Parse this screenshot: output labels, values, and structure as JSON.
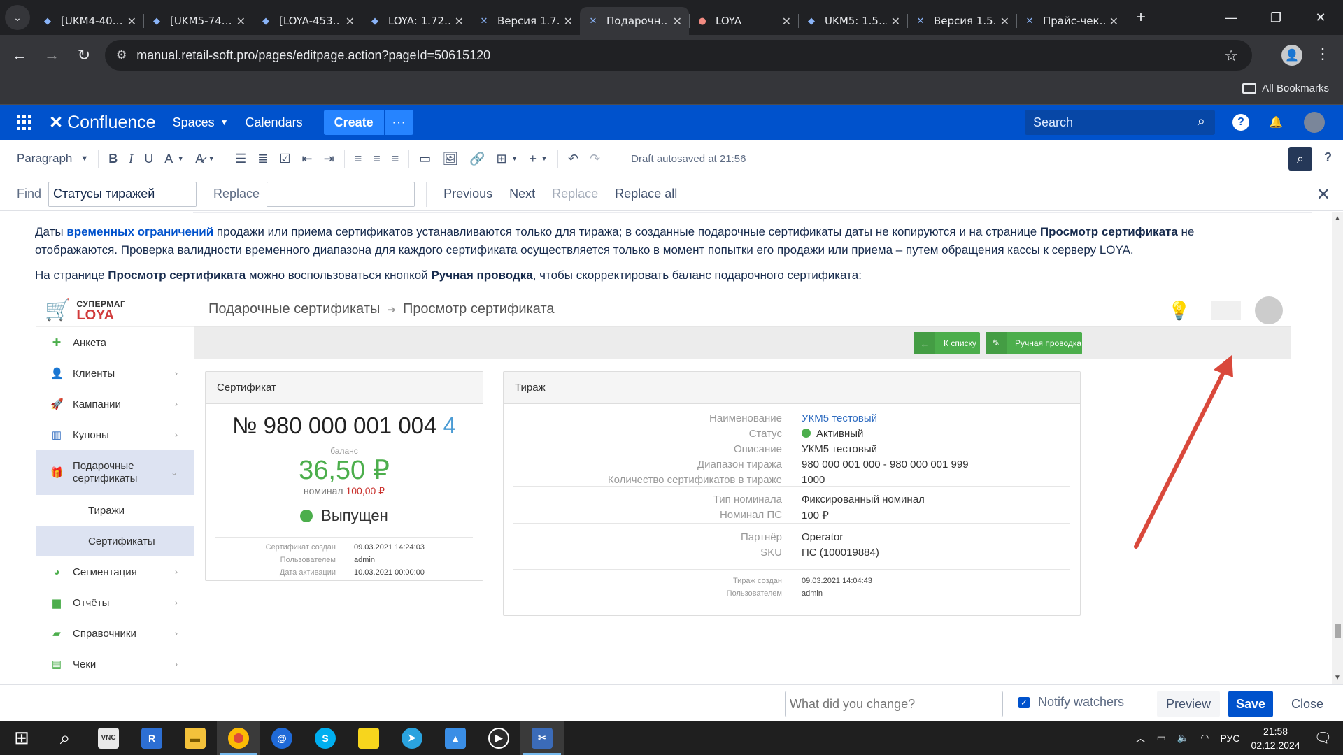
{
  "browser": {
    "tabs": [
      {
        "label": "[UKM4-40…",
        "icon": "jira-icon",
        "color": "#8ab4f8"
      },
      {
        "label": "[UKM5-74…",
        "icon": "jira-icon",
        "color": "#8ab4f8"
      },
      {
        "label": "[LOYA-453…",
        "icon": "jira-icon",
        "color": "#8ab4f8"
      },
      {
        "label": "LOYA: 1.72…",
        "icon": "jira-icon",
        "color": "#8ab4f8"
      },
      {
        "label": "Версия 1.7…",
        "icon": "confluence-icon",
        "color": "#8ab4f8"
      },
      {
        "label": "Подарочн…",
        "icon": "confluence-icon",
        "color": "#8ab4f8",
        "active": true
      },
      {
        "label": "LOYA",
        "icon": "loya-icon",
        "color": "#f28b82"
      },
      {
        "label": "UKM5: 1.5…",
        "icon": "jira-icon",
        "color": "#8ab4f8"
      },
      {
        "label": "Версия 1.5…",
        "icon": "confluence-icon",
        "color": "#8ab4f8"
      },
      {
        "label": "Прайс-чек…",
        "icon": "confluence-icon",
        "color": "#8ab4f8"
      }
    ],
    "url": "manual.retail-soft.pro/pages/editpage.action?pageId=50615120",
    "bookmarks_label": "All Bookmarks"
  },
  "confluence": {
    "logo": "Confluence",
    "nav": {
      "spaces": "Spaces",
      "calendars": "Calendars",
      "create": "Create"
    },
    "search_placeholder": "Search",
    "accent": "#0052cc"
  },
  "toolbar": {
    "paragraph": "Paragraph",
    "autosave": "Draft autosaved at 21:56"
  },
  "findbar": {
    "find_label": "Find",
    "find_value": "Статусы тиражей",
    "replace_label": "Replace",
    "replace_value": "",
    "previous": "Previous",
    "next": "Next",
    "replace": "Replace",
    "replace_all": "Replace all"
  },
  "doc": {
    "p1_a": "Даты ",
    "p1_link": "временных ограничений",
    "p1_b": " продажи или приема сертификатов устанавливаются только для тиража; в созданные подарочные сертификаты даты не копируются и на странице ",
    "p1_bold": "Просмотр сертификата",
    "p1_c": " не отображаются. Проверка валидности временного диапазона для каждого сертификата осуществляется только в момент попытки его продажи или приема – путем обращения кассы к серверу LOYA.",
    "p2_a": "На странице ",
    "p2_bold1": "Просмотр сертификата",
    "p2_b": " можно воспользоваться кнопкой ",
    "p2_bold2": "Ручная проводка",
    "p2_c": ", чтобы скорректировать баланс подарочного сертификата:"
  },
  "shot": {
    "logo_top": "СУПЕРМАГ",
    "logo_bottom": "LOYA",
    "breadcrumb": [
      "Подарочные сертификаты",
      "Просмотр сертификата"
    ],
    "menu": [
      {
        "label": "Анкета",
        "icon": "plus-icon",
        "color": "#4cae4c",
        "arrow": false
      },
      {
        "label": "Клиенты",
        "icon": "user-icon",
        "color": "#2f6cc0",
        "arrow": true
      },
      {
        "label": "Кампании",
        "icon": "rocket-icon",
        "color": "#2f6cc0",
        "arrow": true
      },
      {
        "label": "Купоны",
        "icon": "barcode-icon",
        "color": "#2f6cc0",
        "arrow": true
      }
    ],
    "menu_open": {
      "label": "Подарочные сертификаты",
      "icon": "gift-icon",
      "color": "#4cae4c"
    },
    "submenu": [
      {
        "label": "Тиражи",
        "selected": false
      },
      {
        "label": "Сертификаты",
        "selected": true
      }
    ],
    "menu_after": [
      {
        "label": "Сегментация",
        "icon": "pie-icon",
        "color": "#4cae4c"
      },
      {
        "label": "Отчёты",
        "icon": "bar-chart-icon",
        "color": "#4cae4c"
      },
      {
        "label": "Справочники",
        "icon": "book-icon",
        "color": "#4cae4c"
      },
      {
        "label": "Чеки",
        "icon": "receipt-icon",
        "color": "#4cae4c"
      }
    ],
    "btn_back": "К списку",
    "btn_manual": "Ручная проводка",
    "cert": {
      "title": "Сертификат",
      "number": "№ 980 000 001 004",
      "number_last": "4",
      "balance_label": "баланс",
      "balance": "36,50 ₽",
      "nominal_label": "номинал",
      "nominal": "100,00 ₽",
      "status": "Выпущен",
      "meta_keys": [
        "Сертификат создан",
        "Пользователем",
        "Дата активации"
      ],
      "meta_vals": [
        "09.03.2021 14:24:03",
        "admin",
        "10.03.2021 00:00:00"
      ]
    },
    "batch": {
      "title": "Тираж",
      "rows1": [
        {
          "k": "Наименование",
          "v": "УКМ5 тестовый",
          "link": true
        },
        {
          "k": "Статус",
          "v": "Активный",
          "dot": true
        },
        {
          "k": "Описание",
          "v": "УКМ5 тестовый"
        },
        {
          "k": "Диапазон тиража",
          "v": "980 000 001 000 - 980 000 001 999"
        },
        {
          "k": "Количество сертификатов в тираже",
          "v": "1000"
        }
      ],
      "rows2": [
        {
          "k": "Тип номинала",
          "v": "Фиксированный номинал"
        },
        {
          "k": "Номинал ПС",
          "v": "100 ₽"
        }
      ],
      "rows3": [
        {
          "k": "Партнёр",
          "v": "Operator"
        },
        {
          "k": "SKU",
          "v": "ПС (100019884)"
        }
      ],
      "meta_keys": [
        "Тираж создан",
        "Пользователем"
      ],
      "meta_vals": [
        "09.03.2021 14:04:43",
        "admin"
      ]
    },
    "arrow_color": "#d9483b"
  },
  "savebar": {
    "placeholder": "What did you change?",
    "notify": "Notify watchers",
    "preview": "Preview",
    "save": "Save",
    "close": "Close"
  },
  "taskbar": {
    "lang": "РУС",
    "time": "21:58",
    "date": "02.12.2024"
  }
}
